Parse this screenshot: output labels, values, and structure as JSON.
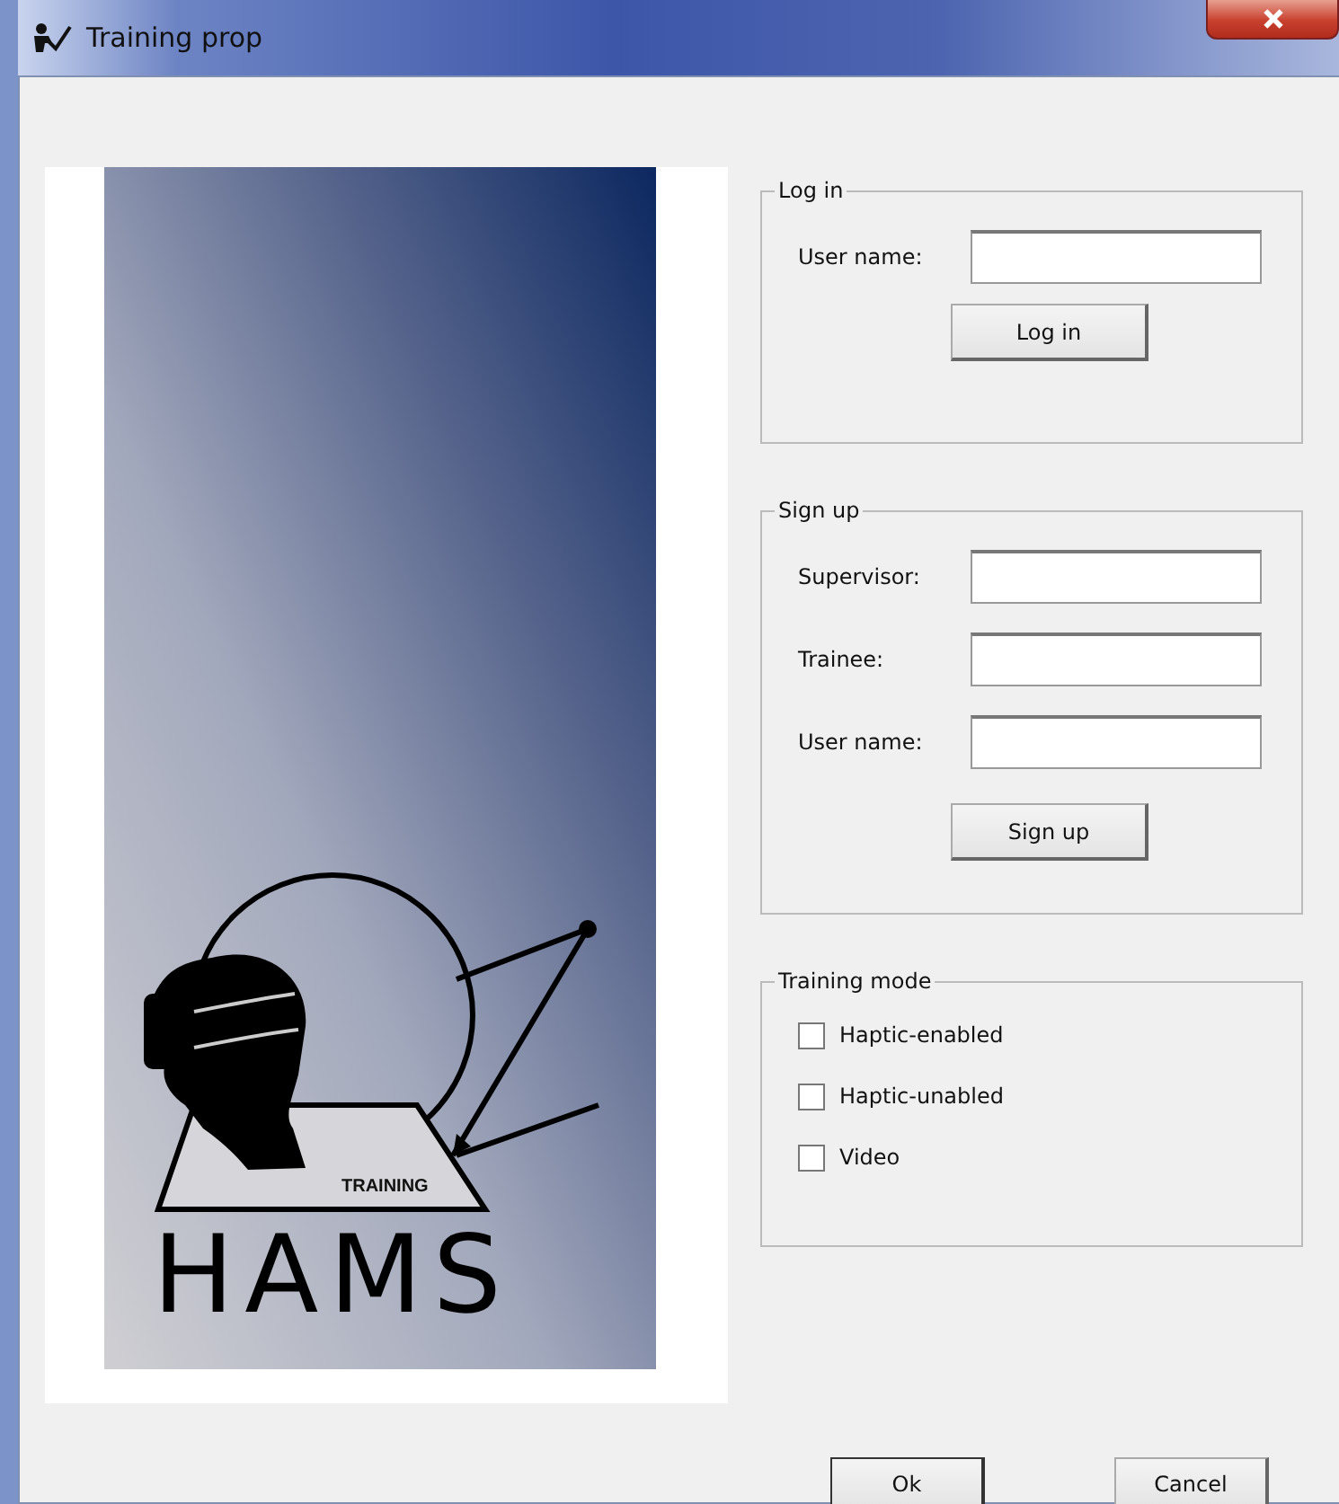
{
  "window": {
    "title": "Training prop"
  },
  "logo": {
    "caption": "TRAINING",
    "name": "HAMS"
  },
  "groups": [
    {
      "kind": "form",
      "title": "Log in",
      "fields": [
        {
          "label": "User name:"
        }
      ],
      "button": "Log in"
    },
    {
      "kind": "form",
      "title": "Sign up",
      "fields": [
        {
          "label": "Supervisor:"
        },
        {
          "label": "Trainee:"
        },
        {
          "label": "User name:"
        }
      ],
      "button": "Sign up"
    },
    {
      "kind": "checks",
      "title": "Training mode",
      "options": [
        {
          "label": "Haptic-enabled",
          "checked": false
        },
        {
          "label": "Haptic-unabled",
          "checked": false
        },
        {
          "label": "Video",
          "checked": false
        }
      ]
    }
  ],
  "buttons": [
    "Ok",
    "Cancel"
  ]
}
